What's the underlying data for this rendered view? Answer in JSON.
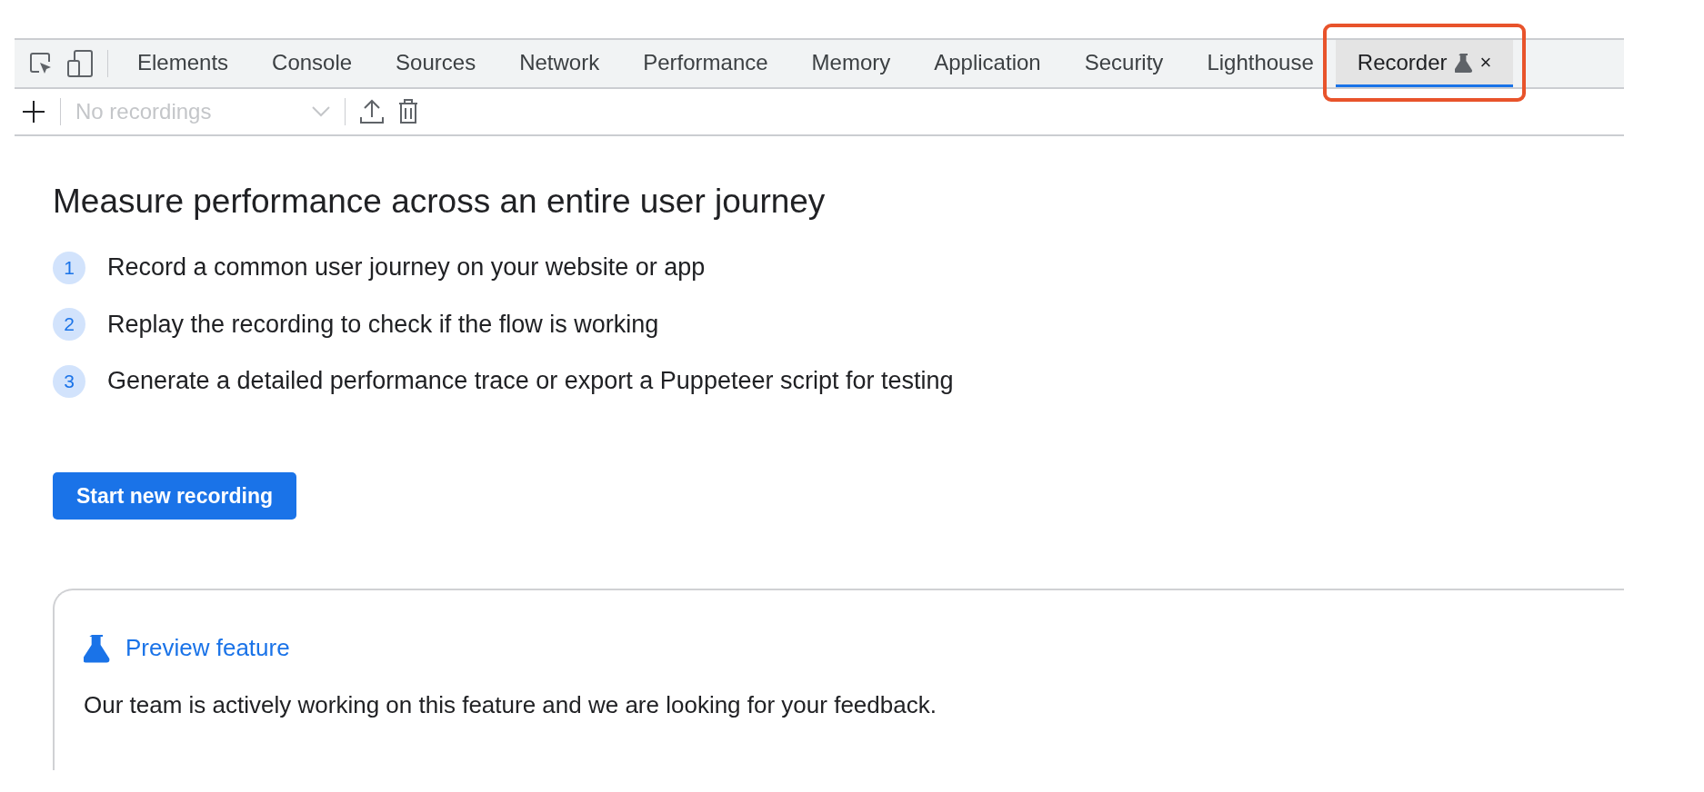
{
  "tabs": [
    {
      "label": "Elements",
      "selected": false
    },
    {
      "label": "Console",
      "selected": false
    },
    {
      "label": "Sources",
      "selected": false
    },
    {
      "label": "Network",
      "selected": false
    },
    {
      "label": "Performance",
      "selected": false
    },
    {
      "label": "Memory",
      "selected": false
    },
    {
      "label": "Application",
      "selected": false
    },
    {
      "label": "Security",
      "selected": false
    },
    {
      "label": "Lighthouse",
      "selected": false
    },
    {
      "label": "Recorder",
      "selected": true,
      "experimental": true,
      "highlighted": true,
      "close_label": "×"
    }
  ],
  "toolbar": {
    "recordings_select": {
      "placeholder": "No recordings",
      "disabled": true
    }
  },
  "heading": "Measure performance across an entire user journey",
  "steps": [
    {
      "number": "1",
      "text": "Record a common user journey on your website or app"
    },
    {
      "number": "2",
      "text": "Replay the recording to check if the flow is working"
    },
    {
      "number": "3",
      "text": "Generate a detailed performance trace or export a Puppeteer script for testing"
    }
  ],
  "start_button": "Start new recording",
  "preview_card": {
    "title": "Preview feature",
    "text": "Our team is actively working on this feature and we are looking for your feedback."
  }
}
